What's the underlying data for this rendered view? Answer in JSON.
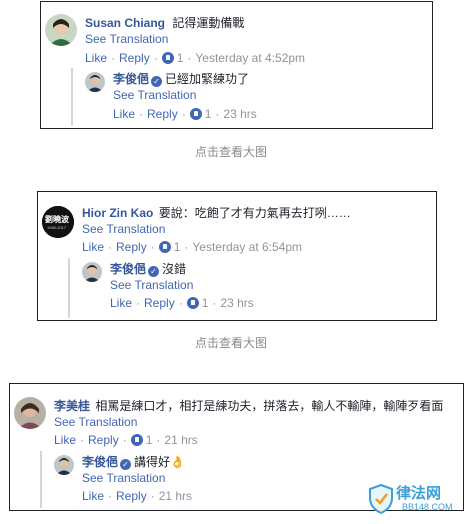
{
  "blocks": [
    {
      "comment": {
        "name": "Susan Chiang",
        "text": "記得運動備戰",
        "see": "See Translation",
        "like": "Like",
        "reply": "Reply",
        "likes": "1",
        "time": "Yesterday at 4:52pm"
      },
      "reply": {
        "name": "李俊俋",
        "text": "已經加緊練功了",
        "see": "See Translation",
        "like": "Like",
        "reply": "Reply",
        "likes": "1",
        "time": "23 hrs"
      }
    },
    {
      "comment": {
        "name": "Hior Zin Kao",
        "text": "要說：吃飽了才有力氣再去打咧……",
        "see": "See Translation",
        "like": "Like",
        "reply": "Reply",
        "likes": "1",
        "time": "Yesterday at 6:54pm",
        "avatar_text": "劉曉波",
        "avatar_sub": "1955-2017"
      },
      "reply": {
        "name": "李俊俋",
        "text": "沒錯",
        "see": "See Translation",
        "like": "Like",
        "reply": "Reply",
        "likes": "1",
        "time": "23 hrs"
      }
    },
    {
      "comment": {
        "name": "李美桂",
        "text": "相罵是練口才，相打是練功夫，拼落去，輸人不輸陣，輸陣歹看面",
        "see": "See Translation",
        "like": "Like",
        "reply": "Reply",
        "likes": "1",
        "time": "21 hrs"
      },
      "reply": {
        "name": "李俊俋",
        "text": "講得好👌",
        "see": "See Translation",
        "like": "Like",
        "reply": "Reply",
        "time": "21 hrs"
      }
    }
  ],
  "captions": [
    "点击查看大图",
    "点击查看大图"
  ],
  "watermark": {
    "text": "律法网",
    "sub": "BB148.COM"
  },
  "colors": {
    "link": "#4267b2",
    "name": "#365899",
    "meta": "#90949c"
  }
}
